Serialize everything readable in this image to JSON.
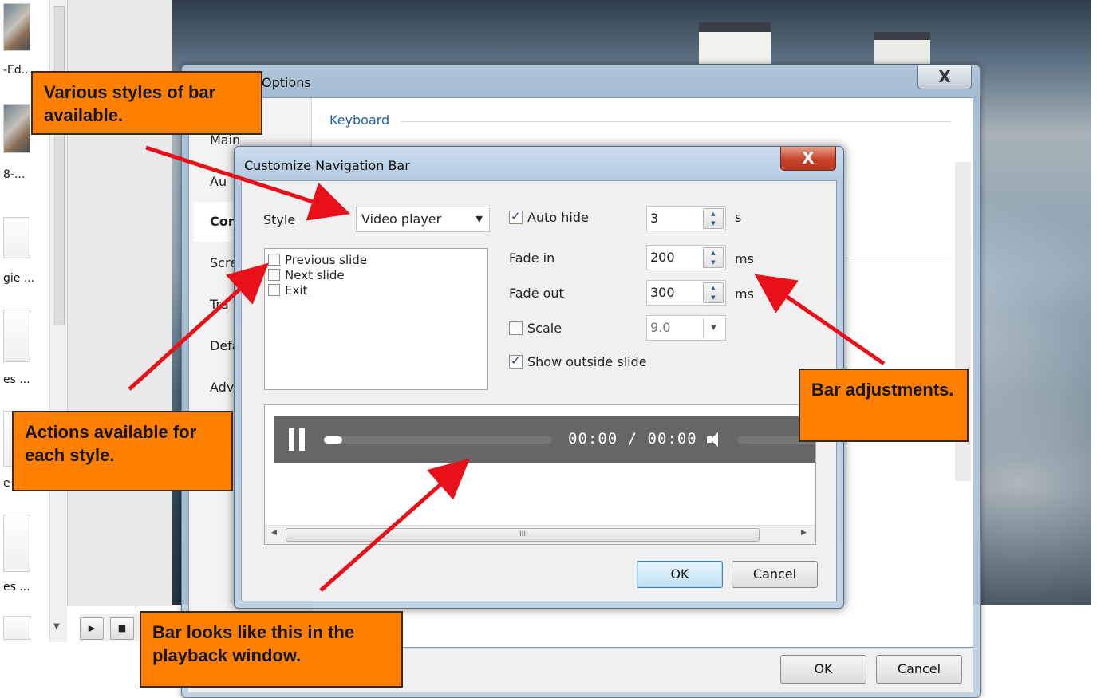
{
  "background_app": {
    "thumbnails": [
      {
        "label": "-Ed..."
      },
      {
        "label": "8-..."
      },
      {
        "label": "gie ..."
      },
      {
        "label": "es ..."
      },
      {
        "label": "e"
      },
      {
        "label": "es ..."
      }
    ],
    "playback": {
      "play_icon": "play-icon",
      "stop_icon": "stop-icon"
    }
  },
  "options_dialog": {
    "title": "Options",
    "close_label": "X",
    "nav": [
      "Main",
      "Au",
      "Con",
      "Scre",
      "Tra",
      "Defa",
      "Adv"
    ],
    "active_nav": "Con",
    "section_keyboard": "Keyboard",
    "ok_label": "OK",
    "cancel_label": "Cancel"
  },
  "customize_dialog": {
    "title": "Customize Navigation Bar",
    "close_label": "X",
    "style_label": "Style",
    "style_value": "Video player",
    "actions": [
      {
        "label": "Previous slide",
        "checked": false
      },
      {
        "label": "Next slide",
        "checked": false
      },
      {
        "label": "Exit",
        "checked": false
      }
    ],
    "auto_hide": {
      "label": "Auto hide",
      "checked": true,
      "value": "3",
      "unit": "s"
    },
    "fade_in": {
      "label": "Fade in",
      "value": "200",
      "unit": "ms"
    },
    "fade_out": {
      "label": "Fade out",
      "value": "300",
      "unit": "ms"
    },
    "scale": {
      "label": "Scale",
      "checked": false,
      "value": "9.0"
    },
    "show_outside": {
      "label": "Show outside slide",
      "checked": true
    },
    "preview_bar": {
      "pause_icon": "pause-icon",
      "time": "00:00 / 00:00",
      "progress": 0.08,
      "volume_icon": "volume-icon"
    },
    "scroll_thumb_text": "III",
    "ok_label": "OK",
    "cancel_label": "Cancel"
  },
  "callouts": {
    "styles": "Various styles of bar available.",
    "actions": "Actions available for each style.",
    "adjustments": "Bar adjustments.",
    "looks": "Bar looks like this in the playback window."
  },
  "colors": {
    "callout": "#ff7f00",
    "arrow": "#e8111a",
    "accent": "#1f5fa8"
  }
}
